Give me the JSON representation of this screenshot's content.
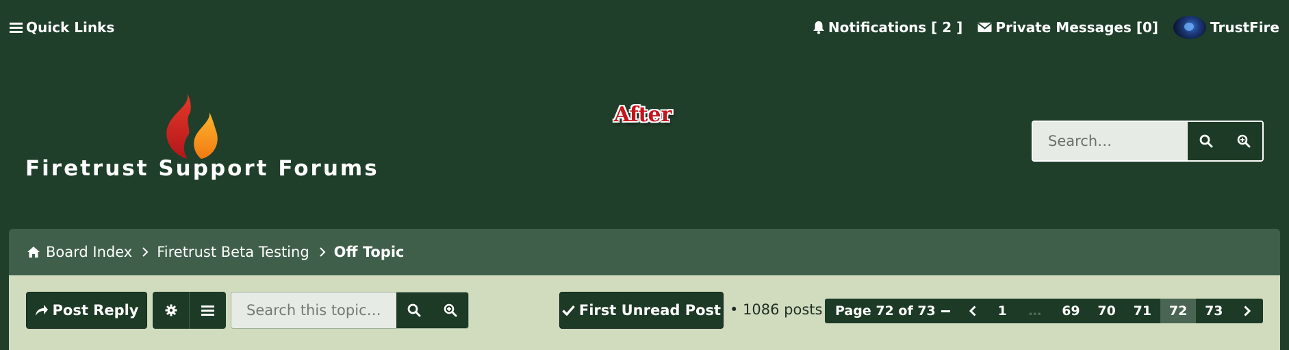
{
  "topnav": {
    "quick_links": "Quick Links",
    "notifications": "Notifications [ 2 ]",
    "private_messages": "Private Messages [0]",
    "username": "TrustFire"
  },
  "header": {
    "site_title": "Firetrust Support Forums",
    "banner_text": "After",
    "search_placeholder": "Search…"
  },
  "breadcrumb": {
    "items": [
      "Board Index",
      "Firetrust Beta Testing",
      "Off Topic"
    ]
  },
  "actions": {
    "post_reply": "Post Reply",
    "topic_search_placeholder": "Search this topic…",
    "first_unread": "First Unread Post",
    "post_count": "• 1086 posts"
  },
  "pagination": {
    "label": "Page 72 of 73",
    "pages": [
      "1",
      "…",
      "69",
      "70",
      "71",
      "72",
      "73"
    ],
    "current": "72"
  },
  "colors": {
    "background": "#1f3f2a",
    "breadcrumb_bar": "#3f5f4a",
    "action_bar": "#d1dcbf",
    "button": "#1c3a25",
    "banner_text": "#c8131a"
  }
}
